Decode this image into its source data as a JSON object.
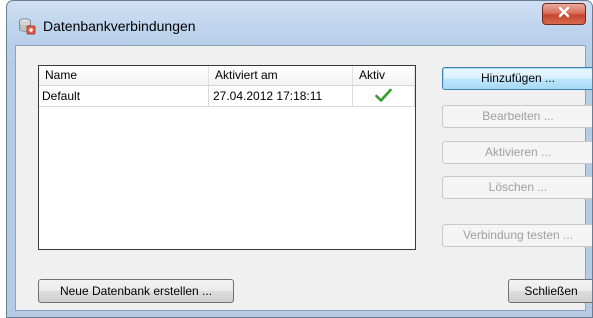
{
  "window": {
    "title": "Datenbankverbindungen",
    "close_glyph": "X"
  },
  "list": {
    "columns": [
      "Name",
      "Aktiviert am",
      "Aktiv"
    ],
    "rows": [
      {
        "name": "Default",
        "activated": "27.04.2012 17:18:11",
        "active": true
      }
    ]
  },
  "buttons": {
    "add": "Hinzufügen ...",
    "edit": "Bearbeiten ...",
    "activate": "Aktivieren ...",
    "delete": "Löschen ...",
    "test_connection": "Verbindung testen ...",
    "new_database": "Neue Datenbank erstellen ...",
    "close": "Schließen"
  },
  "icons": {
    "title_icon": "database-connection-icon",
    "close_icon": "close-icon",
    "active_check": "checkmark-icon"
  },
  "colors": {
    "check_green": "#2f9e2f",
    "close_red": "#c8452e",
    "default_button_border": "#3c7fb1"
  }
}
